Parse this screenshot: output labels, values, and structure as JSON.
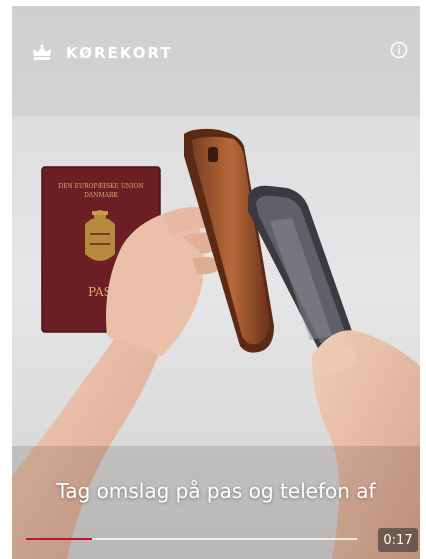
{
  "header": {
    "brand": "KØREKORT",
    "brand_icon": "crown-icon",
    "info_icon": "info-icon"
  },
  "video": {
    "caption": "Tag omslag på pas og telefon af",
    "current_time": "0:17",
    "progress_fraction": 0.2,
    "progress_color": "#c8102e"
  },
  "passport": {
    "header_line1": "DEN EUROPÆISKE UNION",
    "header_line2": "DANMARK",
    "text_pas": "PAS"
  }
}
